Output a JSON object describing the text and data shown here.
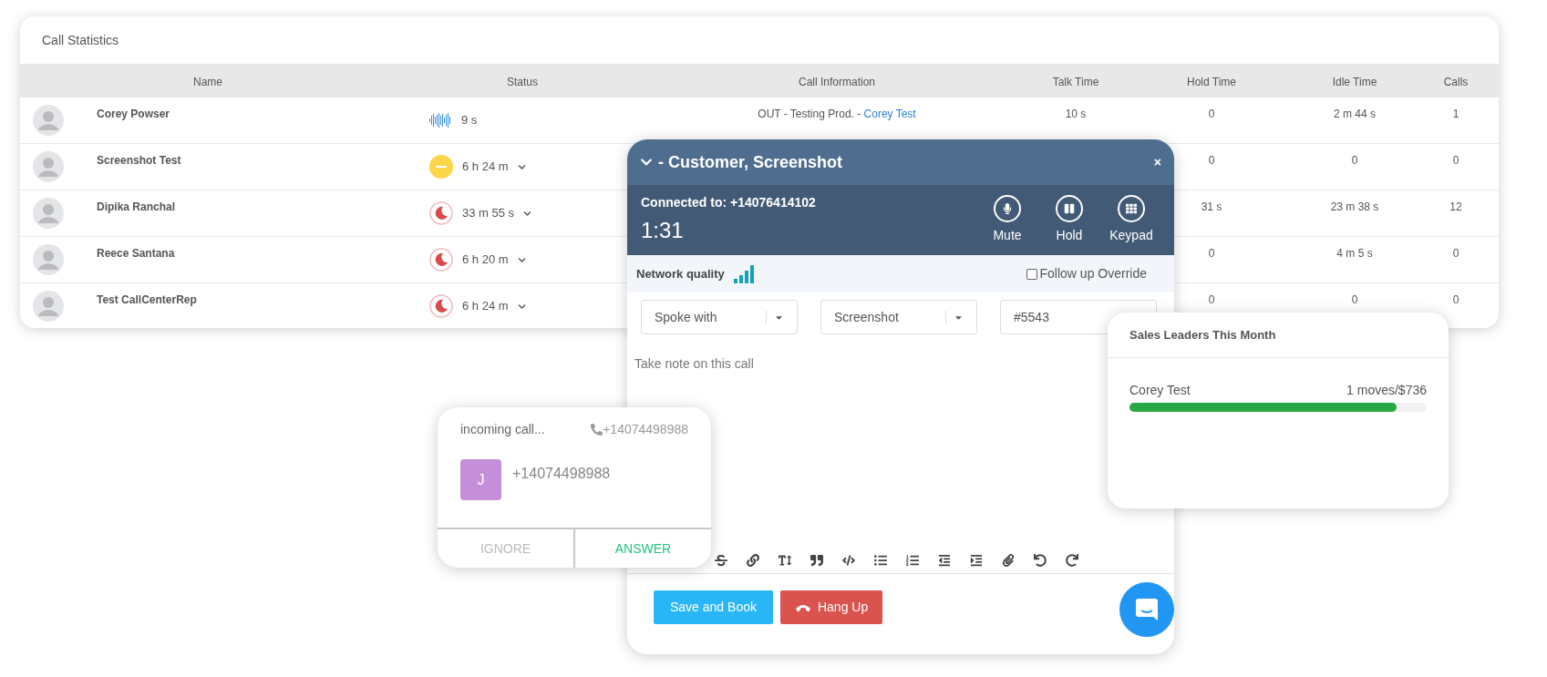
{
  "call_statistics": {
    "title": "Call Statistics",
    "columns": [
      "Name",
      "Status",
      "Call Information",
      "Talk Time",
      "Hold Time",
      "Idle Time",
      "Calls"
    ],
    "rows": [
      {
        "name": "Corey Powser",
        "status": {
          "kind": "on_call",
          "time": "9 s",
          "dropdown": false
        },
        "call_information": {
          "text": "OUT - Testing Prod. - ",
          "link": "Corey Test"
        },
        "talk_time": "10 s",
        "hold_time": "0",
        "idle_time": "2 m 44 s",
        "calls": "1"
      },
      {
        "name": "Screenshot Test",
        "status": {
          "kind": "away",
          "time": "6 h 24 m",
          "dropdown": true
        },
        "hold_time": "0",
        "idle_time": "0",
        "calls": "0"
      },
      {
        "name": "Dipika Ranchal",
        "status": {
          "kind": "sleep",
          "time": "33 m 55 s",
          "dropdown": true
        },
        "hold_time": "31 s",
        "idle_time": "23 m 38 s",
        "calls": "12"
      },
      {
        "name": "Reece Santana",
        "status": {
          "kind": "sleep",
          "time": "6 h 20 m",
          "dropdown": true
        },
        "hold_time": "0",
        "idle_time": "4 m 5 s",
        "calls": "0"
      },
      {
        "name": "Test CallCenterRep",
        "status": {
          "kind": "sleep",
          "time": "6 h 24 m",
          "dropdown": true
        },
        "hold_time": "0",
        "idle_time": "0",
        "calls": "0"
      }
    ]
  },
  "call_panel": {
    "title": "- Customer, Screenshot",
    "close": "×",
    "connected": "Connected to: +14076414102",
    "timer": "1:31",
    "actions": [
      {
        "kind": "mute",
        "label": "Mute"
      },
      {
        "kind": "hold",
        "label": "Hold"
      },
      {
        "kind": "keypad",
        "label": "Keypad"
      }
    ],
    "network_quality": "Network quality",
    "follow_up": {
      "label": "Follow up Override",
      "checked": false
    },
    "fields": [
      {
        "kind": "select",
        "value": "Spoke with"
      },
      {
        "kind": "select",
        "value": "Screenshot"
      },
      {
        "kind": "input",
        "value": "#5543"
      }
    ],
    "note_placeholder": "Take note on this call",
    "buttons": [
      {
        "kind": "save",
        "label": "Save and Book"
      },
      {
        "kind": "hangup",
        "label": "Hang Up"
      }
    ]
  },
  "incoming_call": {
    "label": "incoming call...",
    "phone": "+14074498988",
    "avatar_letter": "J",
    "caller": "+14074498988",
    "buttons": [
      {
        "kind": "ignore",
        "label": "IGNORE"
      },
      {
        "kind": "answer",
        "label": "ANSWER"
      }
    ]
  },
  "sales_leaders": {
    "title": "Sales Leaders This Month",
    "leaders": [
      {
        "name": "Corey Test",
        "value": "1 moves/$736",
        "level": 0.9
      }
    ]
  }
}
